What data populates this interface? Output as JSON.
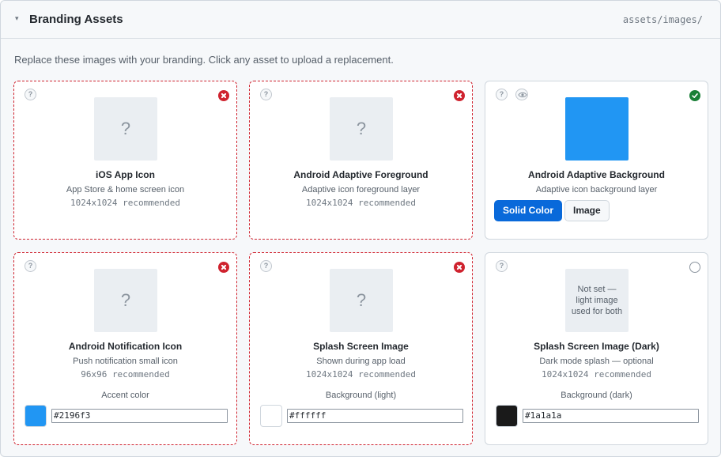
{
  "header": {
    "title": "Branding Assets",
    "path": "assets/images/",
    "collapse_glyph": "▾"
  },
  "description": "Replace these images with your branding. Click any asset to upload a replacement.",
  "help_glyph": "?",
  "placeholder_glyph": "?",
  "assets": [
    {
      "name": "iOS App Icon",
      "subtitle": "App Store & home screen icon",
      "recommended": "1024x1024 recommended",
      "status": "missing",
      "status_icon": "error-x-icon"
    },
    {
      "name": "Android Adaptive Foreground",
      "subtitle": "Adaptive icon foreground layer",
      "recommended": "1024x1024 recommended",
      "status": "missing",
      "status_icon": "error-x-icon"
    },
    {
      "name": "Android Adaptive Background",
      "subtitle": "Adaptive icon background layer",
      "status": "set",
      "status_icon": "check-circle-icon",
      "preview_color": "#2196f3",
      "toggle": {
        "options": [
          "Solid Color",
          "Image"
        ],
        "selected": "Solid Color"
      }
    },
    {
      "name": "Android Notification Icon",
      "subtitle": "Push notification small icon",
      "recommended": "96x96 recommended",
      "status": "missing",
      "status_icon": "error-x-icon",
      "color_label": "Accent color",
      "color_value": "#2196f3"
    },
    {
      "name": "Splash Screen Image",
      "subtitle": "Shown during app load",
      "recommended": "1024x1024 recommended",
      "status": "missing",
      "status_icon": "error-x-icon",
      "color_label": "Background (light)",
      "color_value": "#ffffff"
    },
    {
      "name": "Splash Screen Image (Dark)",
      "subtitle": "Dark mode splash — optional",
      "recommended": "1024x1024 recommended",
      "status": "not-set",
      "status_icon": "empty-circle-icon",
      "placeholder_note": "Not set — light image used for both",
      "color_label": "Background (dark)",
      "color_value": "#1a1a1a"
    }
  ]
}
